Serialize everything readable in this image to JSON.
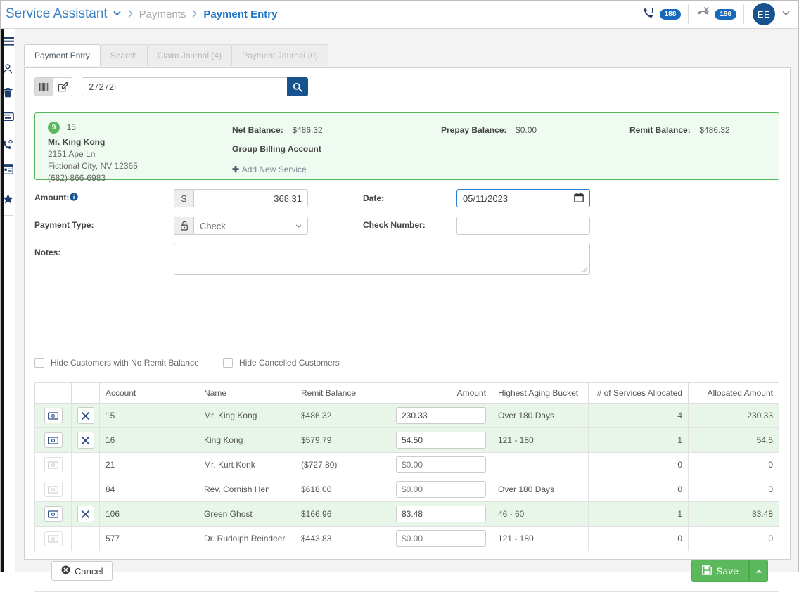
{
  "topbar": {
    "brand": "Service Assistant",
    "brand_caret": "⌄",
    "crumb_sep": "❯",
    "breadcrumb": [
      "Payments",
      "Payment Entry"
    ],
    "phone_badge": "188",
    "missed_call_badge": "186",
    "avatar_initials": "EE",
    "avatar_caret": "⌄"
  },
  "sidebar": {
    "items": [
      {
        "name": "menu",
        "glyph": "≡"
      },
      {
        "name": "customers",
        "glyph": "♟"
      },
      {
        "name": "trash",
        "glyph": "Ὕ1"
      },
      {
        "name": "keyboard",
        "glyph": "⌨"
      },
      {
        "name": "phone",
        "glyph": "☎"
      },
      {
        "name": "id-card",
        "glyph": "▤"
      },
      {
        "name": "favorites",
        "glyph": "☆"
      }
    ]
  },
  "tabs": [
    {
      "label": "Payment Entry",
      "active": true
    },
    {
      "label": "Search",
      "active": false
    },
    {
      "label": "Claim Journal (4)",
      "active": false
    },
    {
      "label": "Payment Journal (0)",
      "active": false
    }
  ],
  "search": {
    "value": "27272i",
    "placeholder": "",
    "barcode_mode_active": true
  },
  "customer": {
    "badge_count": "9",
    "account": "15",
    "name": "Mr. King Kong",
    "address1": "2151 Ape Ln",
    "address2": "Fictional City, NV 12365",
    "phone": "(682) 866-6983",
    "net_balance_label": "Net Balance:",
    "net_balance_value": "$486.32",
    "group_billing_label": "Group Billing Account",
    "add_service_label": "Add New Service",
    "prepay_balance_label": "Prepay Balance:",
    "prepay_balance_value": "$0.00",
    "remit_balance_label": "Remit Balance:",
    "remit_balance_value": "$486.32"
  },
  "form": {
    "amount_label": "Amount:",
    "amount_prefix": "$",
    "amount_value": "368.31",
    "date_label": "Date:",
    "date_value": "05/11/2023",
    "payment_type_label": "Payment Type:",
    "payment_type_value": "Check",
    "check_number_label": "Check Number:",
    "check_number_value": "",
    "notes_label": "Notes:",
    "notes_value": ""
  },
  "filters": {
    "hide_no_remit_label": "Hide Customers with No Remit Balance",
    "hide_no_remit_checked": false,
    "hide_cancelled_label": "Hide Cancelled Customers",
    "hide_cancelled_checked": false
  },
  "table": {
    "headers": [
      "",
      "",
      "Account",
      "Name",
      "Remit Balance",
      "Amount",
      "Highest Aging Bucket",
      "# of Services Allocated",
      "Allocated Amount"
    ],
    "rows": [
      {
        "selected": true,
        "has_remove": true,
        "account": "15",
        "name": "Mr. King Kong",
        "remit_balance": "$486.32",
        "amount": "230.33",
        "amount_is_placeholder": false,
        "aging": "Over 180 Days",
        "services": "4",
        "allocated": "230.33"
      },
      {
        "selected": true,
        "has_remove": true,
        "account": "16",
        "name": "King Kong",
        "remit_balance": "$579.79",
        "amount": "54.50",
        "amount_is_placeholder": false,
        "aging": "121 - 180",
        "services": "1",
        "allocated": "54.5"
      },
      {
        "selected": false,
        "has_remove": false,
        "account": "21",
        "name": "Mr. Kurt Konk",
        "remit_balance": "($727.80)",
        "amount": "$0.00",
        "amount_is_placeholder": true,
        "aging": "",
        "services": "0",
        "allocated": "0"
      },
      {
        "selected": false,
        "has_remove": false,
        "account": "84",
        "name": "Rev. Cornish Hen",
        "remit_balance": "$618.00",
        "amount": "$0.00",
        "amount_is_placeholder": true,
        "aging": "Over 180 Days",
        "services": "0",
        "allocated": "0"
      },
      {
        "selected": true,
        "has_remove": true,
        "account": "106",
        "name": "Green Ghost",
        "remit_balance": "$166.96",
        "amount": "83.48",
        "amount_is_placeholder": false,
        "aging": "46 - 60",
        "services": "1",
        "allocated": "83.48"
      },
      {
        "selected": false,
        "has_remove": false,
        "account": "577",
        "name": "Dr. Rudolph Reindeer",
        "remit_balance": "$443.83",
        "amount": "$0.00",
        "amount_is_placeholder": true,
        "aging": "121 - 180",
        "services": "0",
        "allocated": "0"
      }
    ]
  },
  "footer": {
    "cancel_label": "Cancel",
    "save_label": "Save",
    "save_caret": "▲"
  },
  "colors": {
    "brand_blue": "#3a7fc4",
    "accent_blue": "#17538f",
    "badge_blue": "#1669bb",
    "green_panel_bg": "#effaf0",
    "green_panel_border": "#52b75b",
    "row_selected_bg": "#e8f6e9",
    "save_green": "#5cb85c"
  }
}
